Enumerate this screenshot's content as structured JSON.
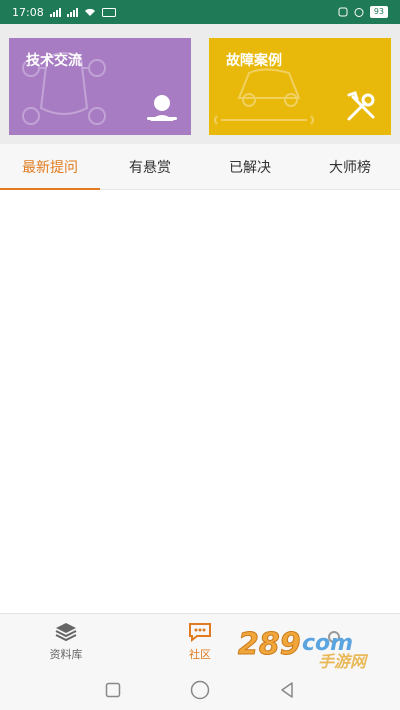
{
  "status_bar": {
    "time": "17:08",
    "battery": "93"
  },
  "cards": [
    {
      "title": "技术交流",
      "color": "#a77cc2",
      "icon": "mechanic-icon"
    },
    {
      "title": "故障案例",
      "color": "#e8b90a",
      "icon": "tools-icon"
    }
  ],
  "tabs": [
    {
      "label": "最新提问",
      "active": true
    },
    {
      "label": "有悬赏",
      "active": false
    },
    {
      "label": "已解决",
      "active": false
    },
    {
      "label": "大师榜",
      "active": false
    }
  ],
  "bottom_nav": [
    {
      "label": "资料库",
      "icon": "layers-icon",
      "active": false
    },
    {
      "label": "社区",
      "icon": "chat-icon",
      "active": true
    }
  ],
  "watermark": {
    "text": "手游网"
  },
  "colors": {
    "accent": "#e27b1f",
    "status_bar": "#1f7a57"
  }
}
